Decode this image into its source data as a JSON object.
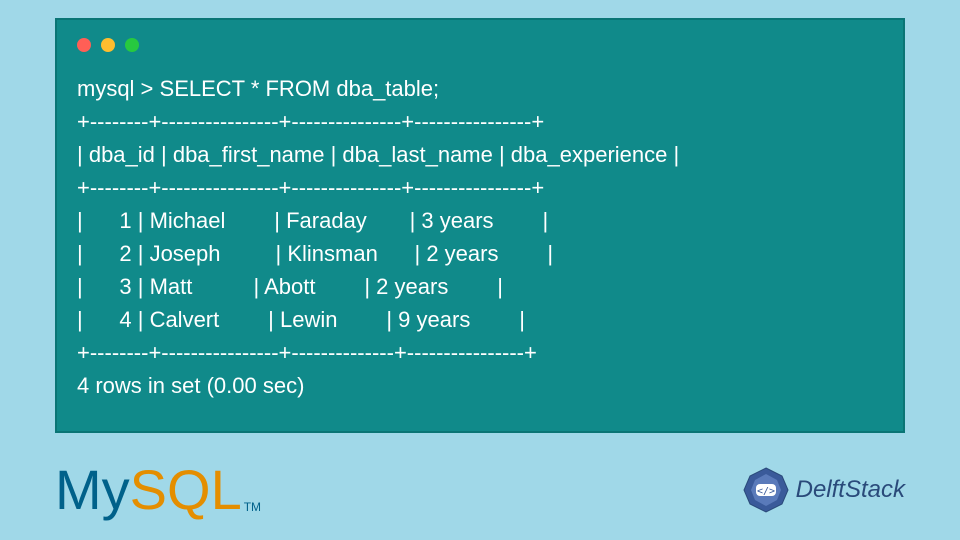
{
  "terminal": {
    "command": "mysql > SELECT * FROM dba_table;",
    "separator1": "+--------+----------------+---------------+----------------+",
    "header": "| dba_id | dba_first_name | dba_last_name | dba_experience |",
    "separator2": "+--------+----------------+---------------+----------------+",
    "row1": "|      1 | Michael        | Faraday       | 3 years        |",
    "row2": "|      2 | Joseph         | Klinsman      | 2 years        |",
    "row3": "|      3 | Matt          | Abott        | 2 years        |",
    "row4": "|      4 | Calvert        | Lewin        | 9 years        |",
    "separator3": "+--------+----------------+--------------+----------------+",
    "footer": "4 rows in set (0.00 sec)"
  },
  "logos": {
    "mysql_my": "My",
    "mysql_sql": "SQL",
    "mysql_tm": "TM",
    "delftstack": "DelftStack"
  },
  "chart_data": {
    "type": "table",
    "title": "dba_table",
    "columns": [
      "dba_id",
      "dba_first_name",
      "dba_last_name",
      "dba_experience"
    ],
    "rows": [
      {
        "dba_id": 1,
        "dba_first_name": "Michael",
        "dba_last_name": "Faraday",
        "dba_experience": "3 years"
      },
      {
        "dba_id": 2,
        "dba_first_name": "Joseph",
        "dba_last_name": "Klinsman",
        "dba_experience": "2 years"
      },
      {
        "dba_id": 3,
        "dba_first_name": "Matt",
        "dba_last_name": "Abott",
        "dba_experience": "2 years"
      },
      {
        "dba_id": 4,
        "dba_first_name": "Calvert",
        "dba_last_name": "Lewin",
        "dba_experience": "9 years"
      }
    ],
    "row_count": 4,
    "execution_time_sec": 0.0
  }
}
